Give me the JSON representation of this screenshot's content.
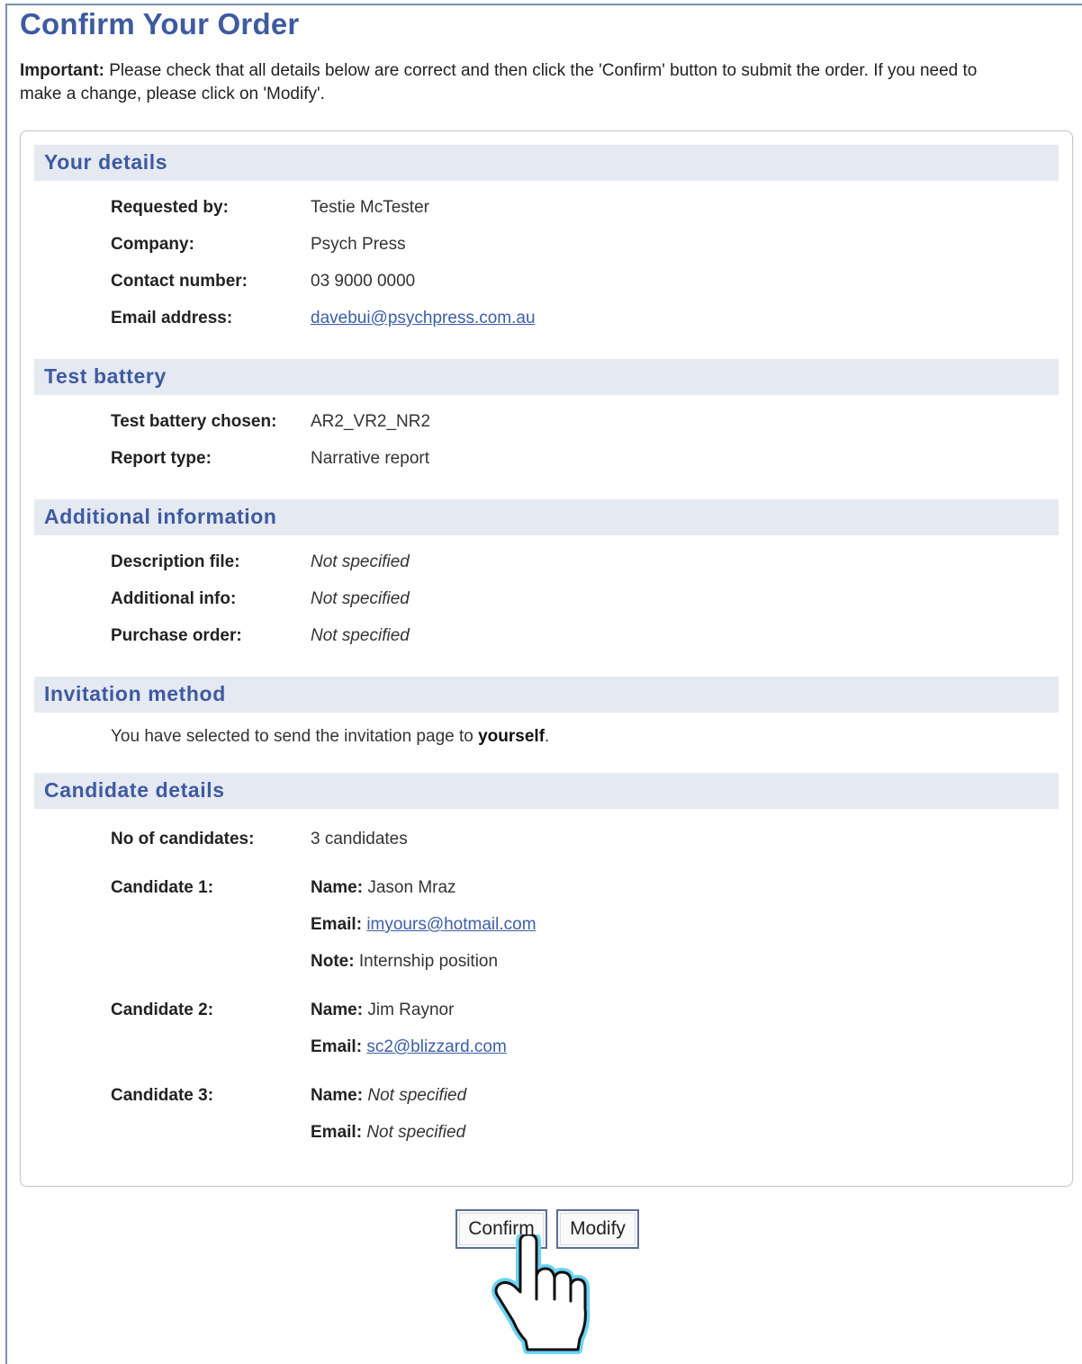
{
  "page": {
    "title": "Confirm Your Order",
    "intro_bold": "Important:",
    "intro_line1": "Please check that all details below are correct and then click the 'Confirm' button to submit the order. If you need to",
    "intro_line2": "make a change, please click on 'Modify'."
  },
  "your_details": {
    "heading": "Your details",
    "requested_by_label": "Requested by:",
    "requested_by_value": "Testie McTester",
    "company_label": "Company:",
    "company_value": "Psych Press",
    "contact_label": "Contact number:",
    "contact_value": "03 9000 0000",
    "email_label": "Email address:",
    "email_value": "davebui@psychpress.com.au"
  },
  "test_battery": {
    "heading": "Test battery",
    "chosen_label": "Test battery chosen:",
    "chosen_value": "AR2_VR2_NR2",
    "report_label": "Report type:",
    "report_value": "Narrative report"
  },
  "additional": {
    "heading": "Additional information",
    "description_label": "Description file:",
    "description_value": "Not specified",
    "info_label": "Additional info:",
    "info_value": "Not specified",
    "po_label": "Purchase order:",
    "po_value": "Not specified"
  },
  "invitation": {
    "heading": "Invitation method",
    "text_prefix": "You have selected to send the invitation page to ",
    "text_bold": "yourself",
    "text_suffix": "."
  },
  "candidates": {
    "heading": "Candidate details",
    "count_label": "No of candidates:",
    "count_value": "3 candidates",
    "name_label": "Name:",
    "email_label": "Email:",
    "note_label": "Note:",
    "c1_label": "Candidate 1:",
    "c1_name": "Jason Mraz",
    "c1_email": "imyours@hotmail.com",
    "c1_note": "Internship position",
    "c2_label": "Candidate 2:",
    "c2_name": "Jim Raynor",
    "c2_email": "sc2@blizzard.com",
    "c3_label": "Candidate 3:",
    "c3_name": "Not specified",
    "c3_email": "Not specified"
  },
  "buttons": {
    "confirm": "Confirm",
    "modify": "Modify"
  },
  "colors": {
    "title_blue": "#3e5aa0",
    "section_bg": "#e5e9f1",
    "link_blue": "#3d5ea8",
    "cursor_glow": "#6ad3f5"
  },
  "icons": {
    "cursor": "hand-pointer-icon"
  }
}
